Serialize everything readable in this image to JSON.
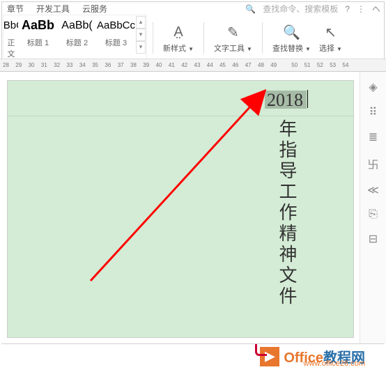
{
  "menu": {
    "chapters": "章节",
    "devtools": "开发工具",
    "cloud": "云服务"
  },
  "search_placeholder": "查找命令、搜索模板",
  "styles": {
    "s1": {
      "preview": "AaBbCcI",
      "label": "正文"
    },
    "s2": {
      "preview": "AaBb",
      "label": "标题 1"
    },
    "s3": {
      "preview": "AaBb(",
      "label": "标题 2"
    },
    "s4": {
      "preview": "AaBbCc",
      "label": "标题 3"
    }
  },
  "tools": {
    "newstyle": "新样式",
    "texttool": "文字工具",
    "findreplace": "查找替换",
    "select": "选择"
  },
  "ruler": {
    "start": 28,
    "end": 54
  },
  "doc": {
    "year": "2018",
    "body": "年指导工作精神文件"
  },
  "watermark": {
    "brand1": "Office",
    "brand2": "教程网",
    "url": "www.office26.com"
  }
}
